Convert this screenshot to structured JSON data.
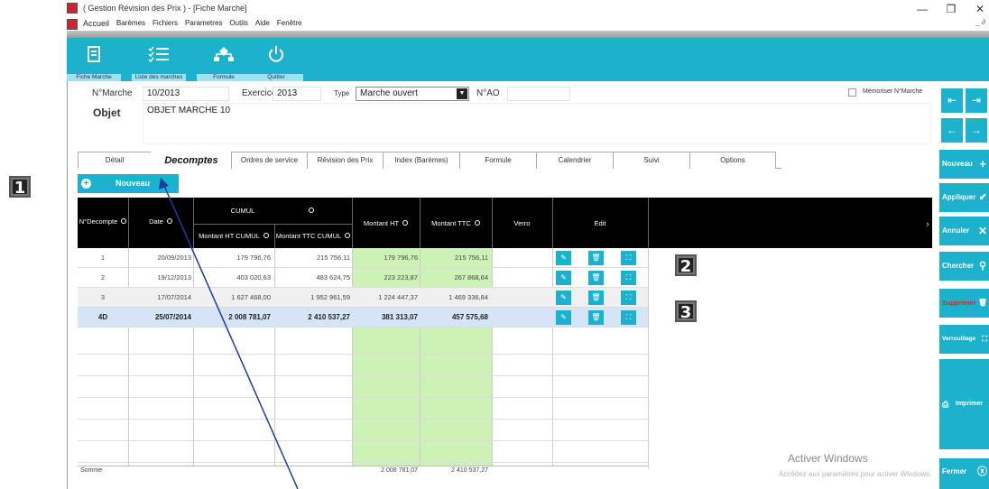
{
  "window": {
    "title": "(   Gestion Révision des Prix   ) - [Fiche Marche]",
    "menu": [
      "Accueil",
      "Barèmes",
      "Fichiers",
      "Parametres",
      "Outils",
      "Aide",
      "Fenêtre"
    ],
    "controls": {
      "minimize": "—",
      "maximize": "❐",
      "close": "✕"
    },
    "mdi_controls": "_ ∂"
  },
  "toolbar": {
    "buttons": [
      {
        "label": "Fiche Marche",
        "icon": "document-icon"
      },
      {
        "label": "Liste des marches",
        "icon": "checklist-icon"
      },
      {
        "label": "Formule",
        "icon": "hierarchy-icon"
      },
      {
        "label": "Quitter",
        "icon": "power-icon"
      }
    ]
  },
  "form": {
    "nmarche_label": "N°Marche",
    "nmarche_value": "10/2013",
    "exercice_label": "Exercice",
    "exercice_value": "2013",
    "type_label": "Type",
    "type_value": "Marche ouvert",
    "nao_label": "N°AO",
    "nao_value": "",
    "memoriser_label": "Mémoriser N°Marche",
    "objet_label": "Objet",
    "objet_value": "OBJET MARCHE 10"
  },
  "tabs": [
    "Détail",
    "Decomptes",
    "Ordres de service",
    "Révision des Prix",
    "Index (Barèmes)",
    "Formule",
    "Calendrier",
    "Suivi",
    "Options"
  ],
  "active_tab": "Decomptes",
  "nouveau_label": "Nouveau",
  "grid": {
    "headers": {
      "ndecompte": "N°Decompte",
      "date": "Date",
      "cumul": "CUMUL",
      "montant_ht_cumul": "Montant HT CUMUL",
      "montant_ttc_cumul": "Montant TTC CUMUL",
      "montant_ht": "Montant HT",
      "montant_ttc": "Montant TTC",
      "verro": "Verro",
      "edit": "Edit"
    },
    "rows": [
      {
        "n": "1",
        "date": "20/09/2013",
        "ht_cumul": "179 796,76",
        "ttc_cumul": "215 756,11",
        "ht": "179 796,76",
        "ttc": "215 756,11"
      },
      {
        "n": "2",
        "date": "19/12/2013",
        "ht_cumul": "403 020,63",
        "ttc_cumul": "483 624,75",
        "ht": "223 223,87",
        "ttc": "267 868,64"
      },
      {
        "n": "3",
        "date": "17/07/2014",
        "ht_cumul": "1 627 468,00",
        "ttc_cumul": "1 952 961,59",
        "ht": "1 224 447,37",
        "ttc": "1 469 336,84"
      },
      {
        "n": "4D",
        "date": "25/07/2014",
        "ht_cumul": "2 008 781,07",
        "ttc_cumul": "2 410 537,27",
        "ht": "381 313,07",
        "ttc": "457 575,68"
      }
    ],
    "somme_label": "Somme",
    "somme_ht": "2 008 781,07",
    "somme_ttc": "2 410 537,27"
  },
  "sidebar": {
    "nouveau": "Nouveau",
    "appliquer": "Appliquer",
    "annuler": "Annuler",
    "chercher": "Chercher",
    "supprimer": "Supprimer",
    "verrouillage": "Verrouillage",
    "imprimer": "Imprimer",
    "fermer": "Fermer"
  },
  "annotations": [
    "1",
    "2",
    "3"
  ],
  "watermark": {
    "line1": "Activer Windows",
    "line2": "Accédez aux paramètres pour activer Windows."
  },
  "colors": {
    "accent": "#1cb1cd",
    "header_bg": "#000000",
    "green_col": "#cdf2b5",
    "selected_row": "#d5e4f6",
    "supprimer_text": "#e0242a"
  }
}
